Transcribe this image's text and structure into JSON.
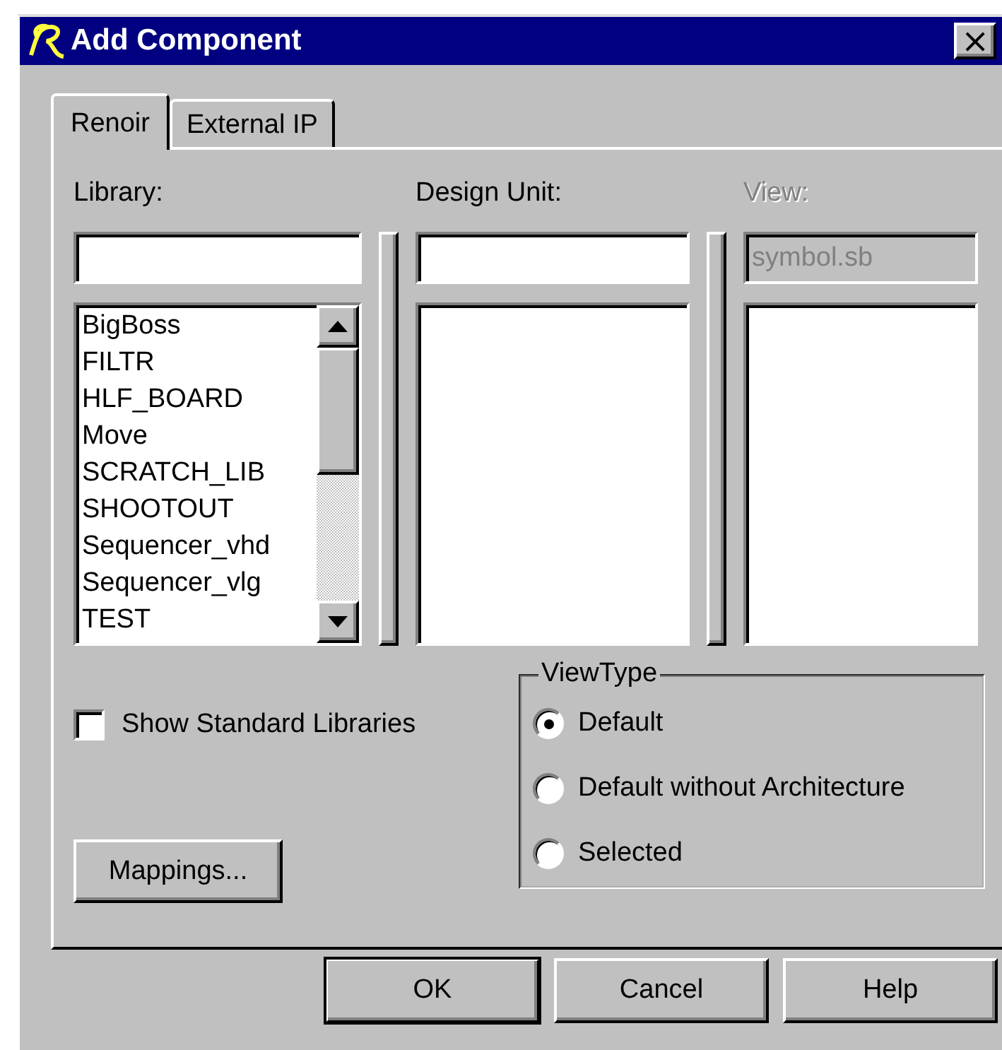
{
  "window": {
    "title": "Add Component",
    "close": "×"
  },
  "tabs": [
    {
      "label": "Renoir",
      "selected": true
    },
    {
      "label": "External IP",
      "selected": false
    }
  ],
  "columns": [
    {
      "label": "Library:",
      "disabled": false,
      "items": [
        "BigBoss",
        "FILTR",
        "HLF_BOARD",
        "Move",
        "SCRATCH_LIB",
        "SHOOTOUT",
        "Sequencer_vhd",
        "Sequencer_vlg",
        "TEST"
      ]
    },
    {
      "label": "Design Unit:",
      "disabled": false
    },
    {
      "label": "View:",
      "disabled": true,
      "value": "symbol.sb"
    }
  ],
  "show_standard_libraries": {
    "label": "Show Standard Libraries",
    "checked": false
  },
  "mappings_button": "Mappings...",
  "view_type": {
    "title": "ViewType",
    "options": [
      {
        "label": "Default",
        "selected": true
      },
      {
        "label": "Default without Architecture",
        "selected": false
      },
      {
        "label": "Selected",
        "selected": false
      }
    ]
  },
  "buttons": [
    {
      "label": "OK",
      "default": true
    },
    {
      "label": "Cancel",
      "default": false
    },
    {
      "label": "Help",
      "default": false
    }
  ]
}
